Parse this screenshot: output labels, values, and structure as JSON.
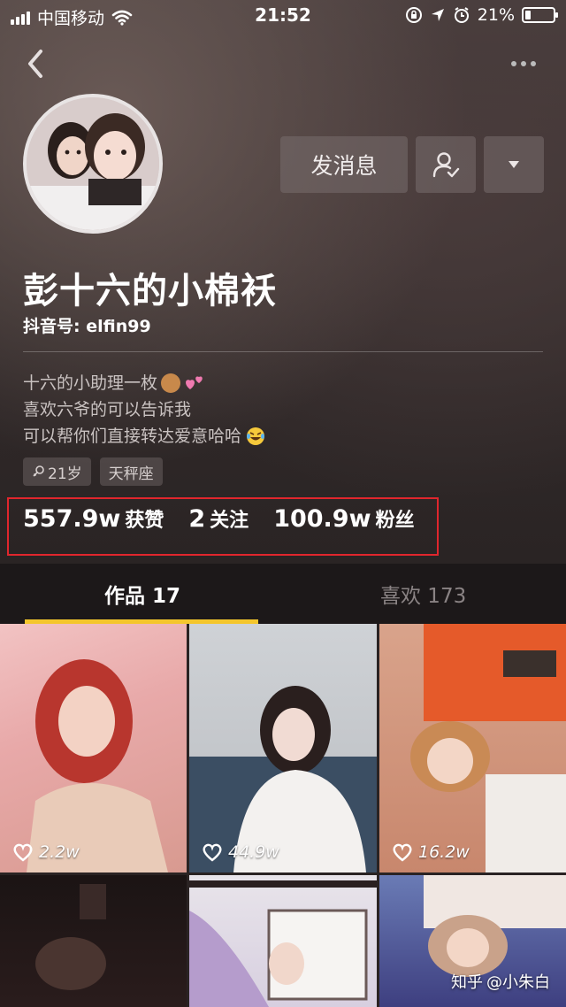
{
  "status_bar": {
    "carrier": "中国移动",
    "time": "21:52",
    "battery": "21%",
    "battery_level": 0.21
  },
  "profile": {
    "message_button": "发消息",
    "nickname": "彭十六的小棉袄",
    "douyin_id": "抖音号: elfin99",
    "bio": [
      "十六的小助理一枚",
      "喜欢六爷的可以告诉我",
      "可以帮你们直接转达爱意哈哈"
    ],
    "tags": [
      {
        "label": "21岁",
        "icon": "female-icon"
      },
      {
        "label": "天秤座"
      }
    ],
    "stats": [
      {
        "num": "557.9w",
        "label": "获赞"
      },
      {
        "num": "2",
        "label": "关注"
      },
      {
        "num": "100.9w",
        "label": "粉丝"
      }
    ],
    "highlight_color": "#e0262d"
  },
  "tabs": [
    {
      "label": "作品 17",
      "active": true
    },
    {
      "label": "喜欢 173",
      "active": false
    }
  ],
  "accent_color": "#f4c62c",
  "videos": [
    {
      "likes": "2.2w"
    },
    {
      "likes": "44.9w"
    },
    {
      "likes": "16.2w"
    },
    {
      "likes": ""
    },
    {
      "likes": ""
    },
    {
      "likes": ""
    }
  ],
  "watermark": {
    "site": "知乎",
    "author": "@小朱白"
  }
}
